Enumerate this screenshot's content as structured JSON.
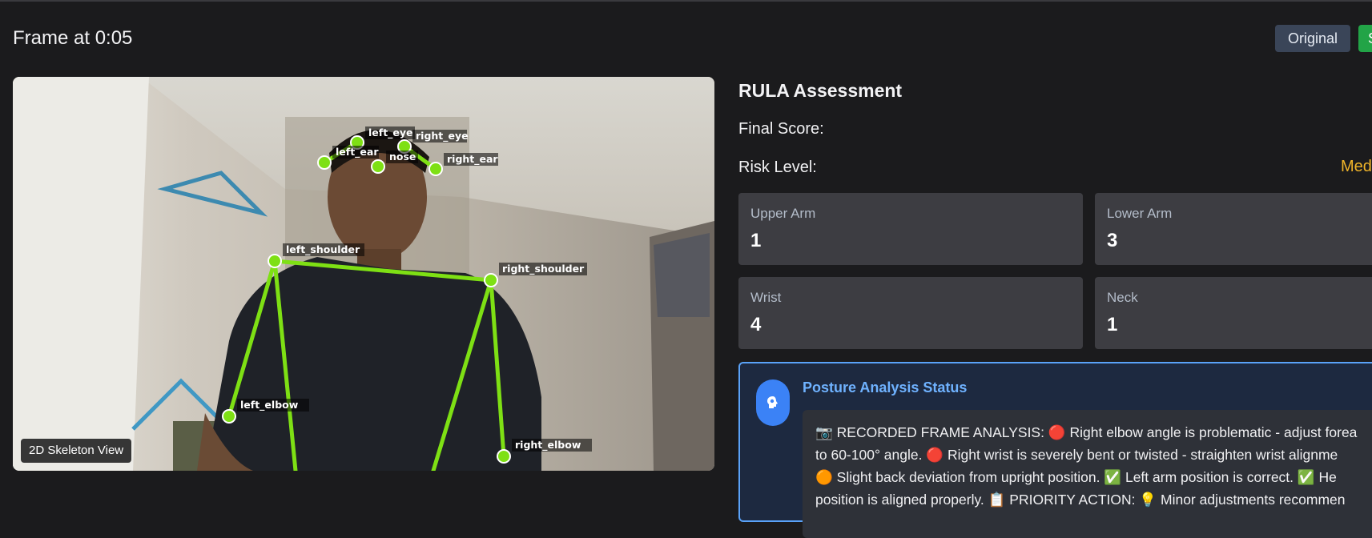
{
  "header": {
    "title": "Frame at 0:05",
    "original_button": "Original",
    "second_button": "S"
  },
  "video": {
    "view_badge": "2D Skeleton View",
    "keypoints": {
      "left_eye": "left_eye",
      "right_eye": "right_eye",
      "left_ear": "left_ear",
      "nose": "nose",
      "right_ear": "right_ear",
      "left_shoulder": "left_shoulder",
      "right_shoulder": "right_shoulder",
      "left_elbow": "left_elbow",
      "right_elbow": "right_elbow"
    },
    "skeleton_color": "#7ee014"
  },
  "rula": {
    "title": "RULA Assessment",
    "final_score_label": "Final Score:",
    "risk_level_label": "Risk Level:",
    "risk_level_value": "Med",
    "risk_color": "#f0b429",
    "cards": {
      "upper_arm": {
        "label": "Upper Arm",
        "value": "1"
      },
      "lower_arm": {
        "label": "Lower Arm",
        "value": "3"
      },
      "wrist": {
        "label": "Wrist",
        "value": "4"
      },
      "neck": {
        "label": "Neck",
        "value": "1"
      }
    }
  },
  "status": {
    "title": "Posture Analysis Status",
    "icon": "brain-icon",
    "line1": "📷 RECORDED FRAME ANALYSIS: 🔴 Right elbow angle is problematic - adjust forea",
    "line2": "to 60-100° angle. 🔴 Right wrist is severely bent or twisted - straighten wrist alignme",
    "line3": "🟠 Slight back deviation from upright position. ✅ Left arm position is correct. ✅ He",
    "line4": "position is aligned properly. 📋 PRIORITY ACTION: 💡 Minor adjustments recommen"
  }
}
